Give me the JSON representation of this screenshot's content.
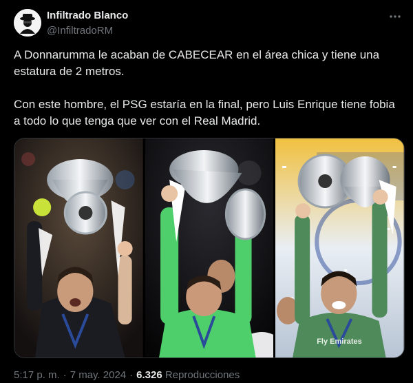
{
  "tweet": {
    "author_name": "Infiltrado Blanco",
    "author_handle": "@InfiltradoRM",
    "text": "A Donnarumma le acaban de CABECEAR en el área chica y tiene una estatura de 2 metros.\n\nCon este hombre, el PSG estaría en la final, pero Luis Enrique tiene fobia a todo lo que tenga que ver con el Real Madrid.",
    "time": "5:17 p. m.",
    "separator": "·",
    "date": "7 may. 2024",
    "views_count": "6.326",
    "views_label": "Reproducciones",
    "shirt_text_3": "Fly Emirates"
  },
  "icons": {
    "more": "more-dots-icon",
    "avatar": "spy-avatar-icon"
  },
  "colors": {
    "background": "#000000",
    "text_primary": "#e7e9ea",
    "text_secondary": "#71767b",
    "border": "#2f3336",
    "kit_green": "#4fcf6b",
    "kit_dark": "#1b1b22"
  }
}
